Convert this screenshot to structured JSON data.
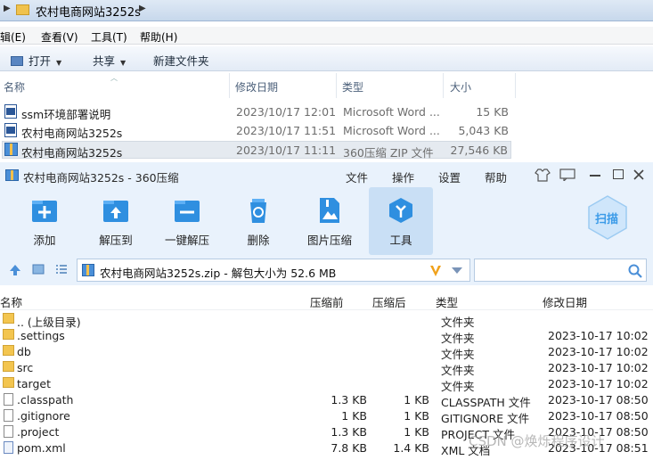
{
  "explorer": {
    "breadcrumb": "农村电商网站3252s",
    "menu": [
      "辑(E)",
      "查看(V)",
      "工具(T)",
      "帮助(H)"
    ],
    "toolbar": {
      "open": "打开",
      "share": "共享",
      "new_folder": "新建文件夹"
    },
    "columns": {
      "name": "名称",
      "date": "修改日期",
      "type": "类型",
      "size": "大小"
    },
    "files": [
      {
        "name": "ssm环境部署说明",
        "date": "2023/10/17 12:01",
        "type": "Microsoft Word ...",
        "size": "15 KB",
        "icon": "word-doc-icon"
      },
      {
        "name": "农村电商网站3252s",
        "date": "2023/10/17 11:51",
        "type": "Microsoft Word ...",
        "size": "5,043 KB",
        "icon": "word-doc-icon"
      },
      {
        "name": "农村电商网站3252s",
        "date": "2023/10/17 11:11",
        "type": "360压缩 ZIP 文件",
        "size": "27,546 KB",
        "icon": "zip-archive-icon"
      }
    ]
  },
  "zip": {
    "title": "农村电商网站3252s - 360压缩",
    "menu": [
      "文件",
      "操作",
      "设置",
      "帮助"
    ],
    "tools": [
      "添加",
      "解压到",
      "一键解压",
      "删除",
      "图片压缩",
      "工具"
    ],
    "scan_label": "扫描",
    "path_text": "农村电商网站3252s.zip - 解包大小为 52.6 MB",
    "columns": {
      "name": "名称",
      "packed": "压缩前",
      "unpacked": "压缩后",
      "type": "类型",
      "modified": "修改日期"
    },
    "entries": [
      {
        "name": ".. (上级目录)",
        "before": "",
        "after": "",
        "type": "文件夹",
        "date": "",
        "kind": "folder"
      },
      {
        "name": ".settings",
        "before": "",
        "after": "",
        "type": "文件夹",
        "date": "2023-10-17 10:02",
        "kind": "folder"
      },
      {
        "name": "db",
        "before": "",
        "after": "",
        "type": "文件夹",
        "date": "2023-10-17 10:02",
        "kind": "folder"
      },
      {
        "name": "src",
        "before": "",
        "after": "",
        "type": "文件夹",
        "date": "2023-10-17 10:02",
        "kind": "folder"
      },
      {
        "name": "target",
        "before": "",
        "after": "",
        "type": "文件夹",
        "date": "2023-10-17 10:02",
        "kind": "folder"
      },
      {
        "name": ".classpath",
        "before": "1.3 KB",
        "after": "1 KB",
        "type": "CLASSPATH 文件",
        "date": "2023-10-17 08:50",
        "kind": "file"
      },
      {
        "name": ".gitignore",
        "before": "1 KB",
        "after": "1 KB",
        "type": "GITIGNORE 文件",
        "date": "2023-10-17 08:50",
        "kind": "file"
      },
      {
        "name": ".project",
        "before": "1.3 KB",
        "after": "1 KB",
        "type": "PROJECT 文件",
        "date": "2023-10-17 08:50",
        "kind": "file"
      },
      {
        "name": "pom.xml",
        "before": "7.8 KB",
        "after": "1.4 KB",
        "type": "XML 文档",
        "date": "2023-10-17 08:51",
        "kind": "xml"
      }
    ]
  },
  "watermark": "CSDN @焕烁程序设计"
}
